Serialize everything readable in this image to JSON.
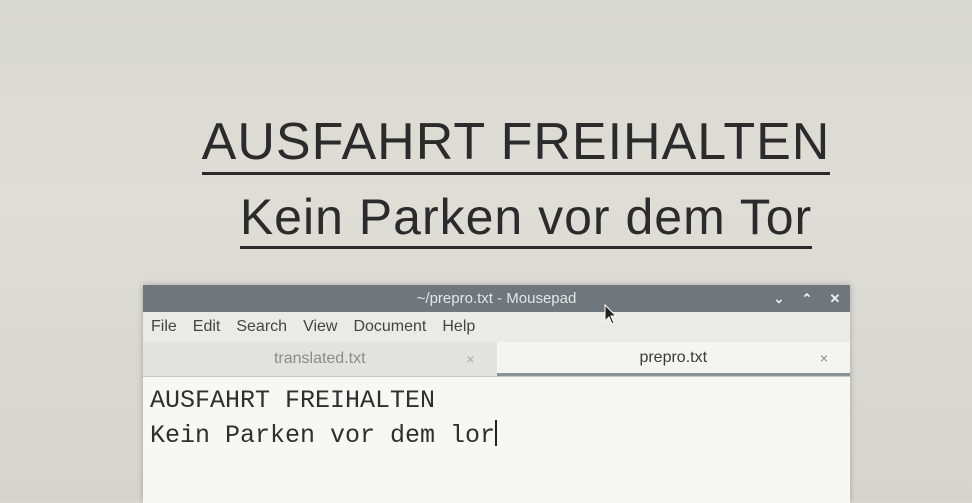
{
  "sign": {
    "line1": "AUSFAHRT FREIHALTEN",
    "line2": "Kein Parken vor dem Tor"
  },
  "window": {
    "title": "~/prepro.txt - Mousepad",
    "controls": [
      "⌄",
      "⌃",
      "✕"
    ]
  },
  "menu": [
    "File",
    "Edit",
    "Search",
    "View",
    "Document",
    "Help"
  ],
  "tabs": [
    {
      "label": "translated.txt",
      "close": "×",
      "active": false
    },
    {
      "label": "prepro.txt",
      "close": "×",
      "active": true
    }
  ],
  "editor": {
    "lines": [
      "AUSFAHRT FREIHALTEN",
      "Kein Parken vor dem lor"
    ]
  },
  "colors": {
    "titlebar": "#6f777c",
    "editor_bg": "#f7f7f5"
  }
}
